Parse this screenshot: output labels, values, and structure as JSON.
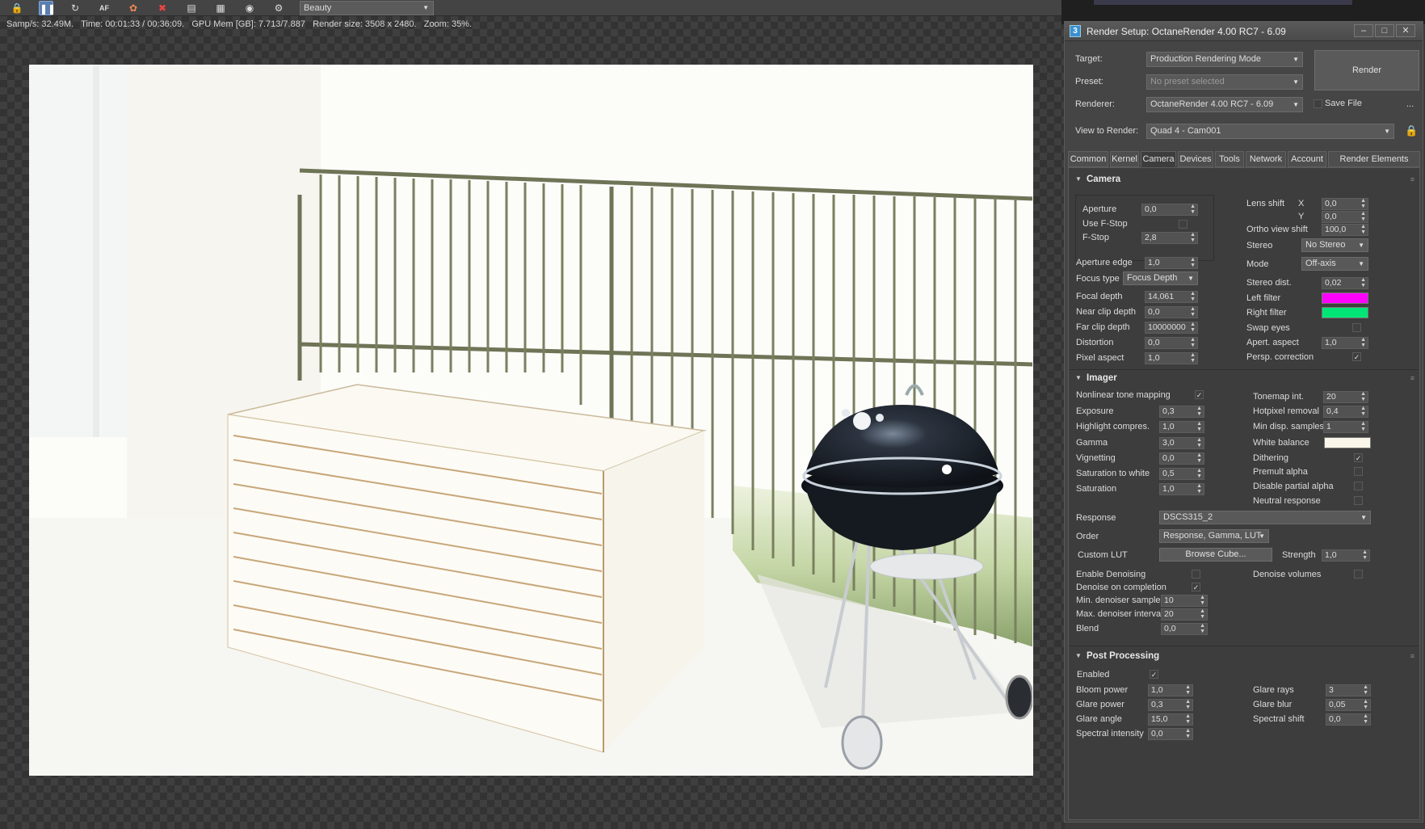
{
  "viewport": {
    "channel": "Beauty",
    "status": {
      "samples": "Samp/s: 32.49M.",
      "time": "Time: 00:01:33 / 00:36:09.",
      "gpu_mem": "GPU Mem [GB]: 7.713/7.887",
      "render_size": "Render size: 3508 x 2480.",
      "zoom": "Zoom: 35%."
    },
    "toolbar_icons": [
      "lock-icon",
      "pause-icon",
      "refresh-icon",
      "af-icon",
      "color-picker-icon",
      "region-icon",
      "frame-buffer-icon",
      "film-icon",
      "camera-icon",
      "settings-icon"
    ]
  },
  "dialog": {
    "title": "Render Setup: OctaneRender 4.00 RC7 - 6.09",
    "target_label": "Target:",
    "target_value": "Production Rendering Mode",
    "preset_label": "Preset:",
    "preset_value": "No preset selected",
    "renderer_label": "Renderer:",
    "renderer_value": "OctaneRender 4.00 RC7 - 6.09",
    "save_file_label": "Save File",
    "more_label": "...",
    "view_label": "View to Render:",
    "view_value": "Quad 4 - Cam001",
    "render_button": "Render",
    "tabs": [
      "Common",
      "Kernel",
      "Camera",
      "Devices",
      "Tools",
      "Network",
      "Account",
      "Render Elements"
    ],
    "active_tab": "Camera"
  },
  "camera": {
    "title": "Camera",
    "aperture_label": "Aperture",
    "aperture": "0,0",
    "use_fstop_label": "Use F-Stop",
    "fstop_label": "F-Stop",
    "fstop": "2,8",
    "aperture_edge_label": "Aperture edge",
    "aperture_edge": "1,0",
    "focus_type_label": "Focus type",
    "focus_type": "Focus Depth",
    "focal_depth_label": "Focal depth",
    "focal_depth": "14,061",
    "near_clip_label": "Near clip depth",
    "near_clip": "0,0",
    "far_clip_label": "Far clip depth",
    "far_clip": "10000000",
    "distortion_label": "Distortion",
    "distortion": "0,0",
    "pixel_aspect_label": "Pixel aspect",
    "pixel_aspect": "1,0",
    "lens_shift_label": "Lens shift",
    "x_label": "X",
    "lens_x": "0,0",
    "y_label": "Y",
    "lens_y": "0,0",
    "ortho_label": "Ortho view shift",
    "ortho": "100,0",
    "stereo_label": "Stereo",
    "stereo": "No Stereo",
    "mode_label": "Mode",
    "mode": "Off-axis",
    "stereo_dist_label": "Stereo dist.",
    "stereo_dist": "0,02",
    "left_filter_label": "Left filter",
    "left_filter_color": "#ff00ff",
    "right_filter_label": "Right filter",
    "right_filter_color": "#00e676",
    "swap_eyes_label": "Swap eyes",
    "apert_aspect_label": "Apert. aspect",
    "apert_aspect": "1,0",
    "persp_label": "Persp. correction"
  },
  "imager": {
    "title": "Imager",
    "nonlinear_label": "Nonlinear tone mapping",
    "exposure_label": "Exposure",
    "exposure": "0,3",
    "highlight_label": "Highlight compres.",
    "highlight": "1,0",
    "gamma_label": "Gamma",
    "gamma": "3,0",
    "vignetting_label": "Vignetting",
    "vignetting": "0,0",
    "sat_white_label": "Saturation to white",
    "sat_white": "0,5",
    "saturation_label": "Saturation",
    "saturation": "1,0",
    "tonemap_label": "Tonemap int.",
    "tonemap": "20",
    "hotpixel_label": "Hotpixel removal",
    "hotpixel": "0,4",
    "min_disp_label": "Min disp. samples",
    "min_disp": "1",
    "white_balance_label": "White balance",
    "white_balance_color": "#fbf6ea",
    "dithering_label": "Dithering",
    "premult_label": "Premult alpha",
    "disable_partial_label": "Disable partial alpha",
    "neutral_label": "Neutral response",
    "response_label": "Response",
    "response": "DSCS315_2",
    "order_label": "Order",
    "order": "Response, Gamma, LUT",
    "custom_lut_label": "Custom LUT",
    "browse_label": "Browse Cube...",
    "strength_label": "Strength",
    "strength": "1,0",
    "enable_denoise_label": "Enable Denoising",
    "denoise_volumes_label": "Denoise volumes",
    "denoise_completion_label": "Denoise on completion",
    "min_denoiser_label": "Min. denoiser samples",
    "min_denoiser": "10",
    "max_denoiser_label": "Max. denoiser interva",
    "max_denoiser": "20",
    "blend_label": "Blend",
    "blend": "0,0"
  },
  "post": {
    "title": "Post Processing",
    "enabled_label": "Enabled",
    "bloom_label": "Bloom power",
    "bloom": "1,0",
    "glare_power_label": "Glare power",
    "glare_power": "0,3",
    "glare_angle_label": "Glare angle",
    "glare_angle": "15,0",
    "spectral_int_label": "Spectral intensity",
    "spectral_int": "0,0",
    "glare_rays_label": "Glare rays",
    "glare_rays": "3",
    "glare_blur_label": "Glare blur",
    "glare_blur": "0,05",
    "spectral_shift_label": "Spectral shift",
    "spectral_shift": "0,0"
  }
}
